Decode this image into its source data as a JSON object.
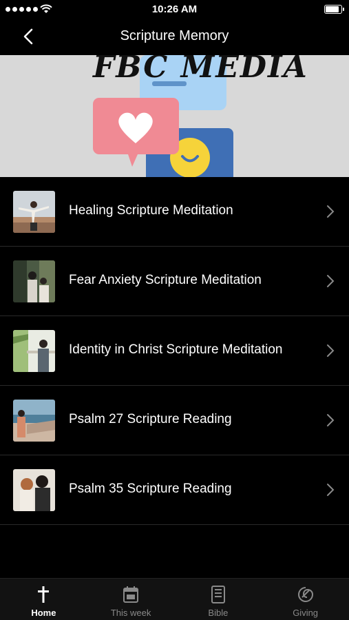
{
  "status_bar": {
    "time": "10:26 AM"
  },
  "nav": {
    "title": "Scripture Memory"
  },
  "banner": {
    "text": "FBC MEDIA"
  },
  "items": [
    {
      "label": "Healing Scripture Meditation"
    },
    {
      "label": "Fear Anxiety Scripture Meditation"
    },
    {
      "label": "Identity in Christ Scripture Meditation"
    },
    {
      "label": "Psalm 27 Scripture Reading"
    },
    {
      "label": "Psalm 35 Scripture Reading"
    }
  ],
  "tabs": [
    {
      "label": "Home",
      "icon": "cross-icon",
      "active": true
    },
    {
      "label": "This week",
      "icon": "calendar-icon"
    },
    {
      "label": "Bible",
      "icon": "bible-icon"
    },
    {
      "label": "Giving",
      "icon": "giving-icon"
    }
  ],
  "colors": {
    "background": "#000000",
    "banner_bg": "#d8d8d8",
    "heart_card": "#f08a94",
    "chat_blue": "#3f6fb5",
    "smiley": "#f6d33a"
  }
}
